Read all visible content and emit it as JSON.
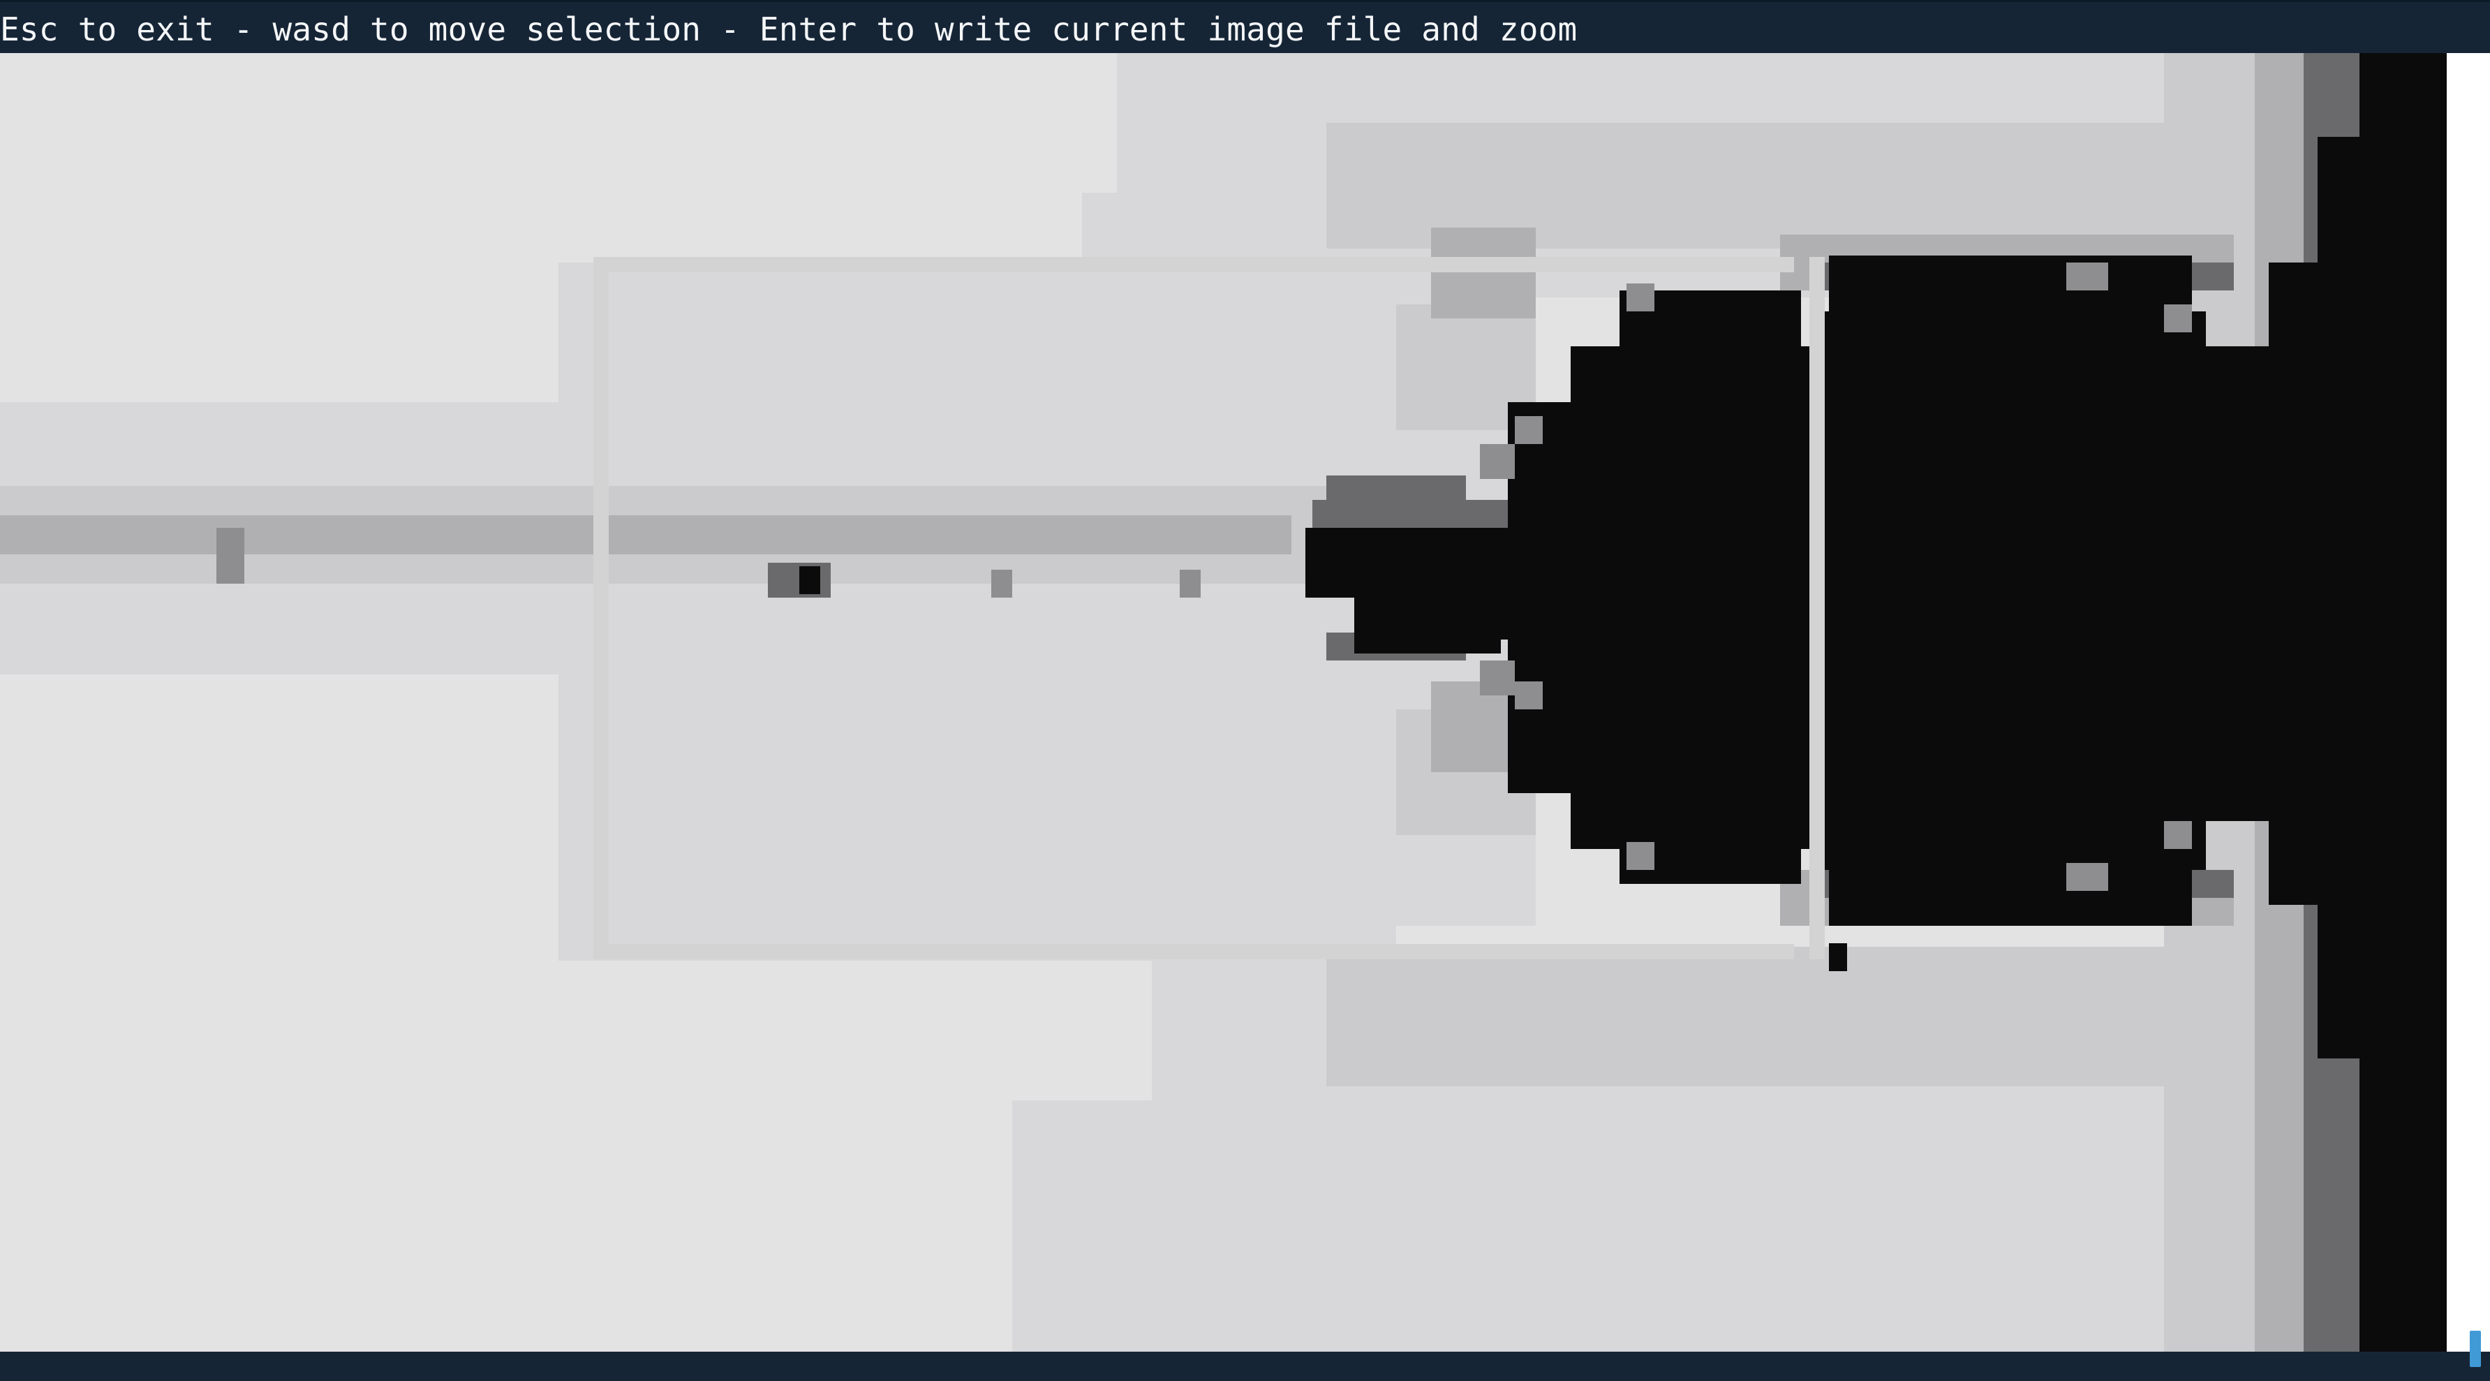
{
  "header": {
    "instructions": "Esc to exit - wasd to move selection - Enter to write current image file and zoom"
  },
  "viewer": {
    "content": "mandelbrot-set-render",
    "palette": {
      "background": "#e3e3e4",
      "light_gray": "#d4d4d6",
      "mid_gray": "#bcbcbe",
      "dark_gray": "#5a5a5c",
      "set_black": "#0b0b0b",
      "selection": "#d3d3d3"
    }
  },
  "colors": {
    "chrome": "#162536",
    "text": "#f4f6f8",
    "scrollbar": "#3f9ad6"
  }
}
